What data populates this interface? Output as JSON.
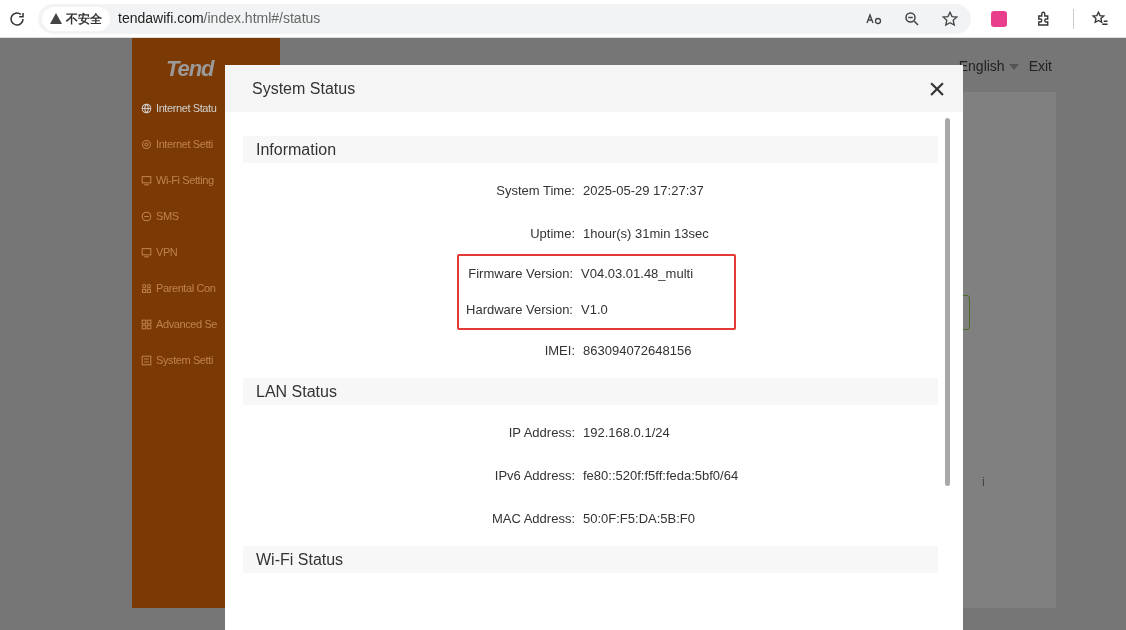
{
  "browser": {
    "security_label": "不安全",
    "url_host": "tendawifi.com",
    "url_path": "/index.html#/status"
  },
  "app": {
    "logo": "Tend",
    "sidebar": [
      {
        "label": "Internet Statu",
        "selected": true
      },
      {
        "label": "Internet Setti",
        "selected": false
      },
      {
        "label": "Wi-Fi Setting",
        "selected": false
      },
      {
        "label": "SMS",
        "selected": false
      },
      {
        "label": "VPN",
        "selected": false
      },
      {
        "label": "Parental Con",
        "selected": false
      },
      {
        "label": "Advanced Se",
        "selected": false
      },
      {
        "label": "System Setti",
        "selected": false
      }
    ],
    "language": "English",
    "exit": "Exit",
    "peek_text": "i"
  },
  "dialog": {
    "title": "System Status",
    "close": "×",
    "sections": [
      {
        "title": "Information",
        "rows": [
          {
            "label": "System Time:",
            "value": "2025-05-29 17:27:37",
            "highlighted": false
          },
          {
            "label": "Uptime:",
            "value": "1hour(s) 31min 13sec",
            "highlighted": false
          },
          {
            "label": "Firmware Version:",
            "value": "V04.03.01.48_multi",
            "highlighted": true
          },
          {
            "label": "Hardware Version:",
            "value": "V1.0",
            "highlighted": true
          },
          {
            "label": "IMEI:",
            "value": "863094072648156",
            "highlighted": false
          }
        ]
      },
      {
        "title": "LAN Status",
        "rows": [
          {
            "label": "IP Address:",
            "value": "192.168.0.1/24",
            "highlighted": false
          },
          {
            "label": "IPv6 Address:",
            "value": "fe80::520f:f5ff:feda:5bf0/64",
            "highlighted": false
          },
          {
            "label": "MAC Address:",
            "value": "50:0F:F5:DA:5B:F0",
            "highlighted": false
          }
        ]
      },
      {
        "title": "Wi-Fi Status"
      }
    ]
  }
}
